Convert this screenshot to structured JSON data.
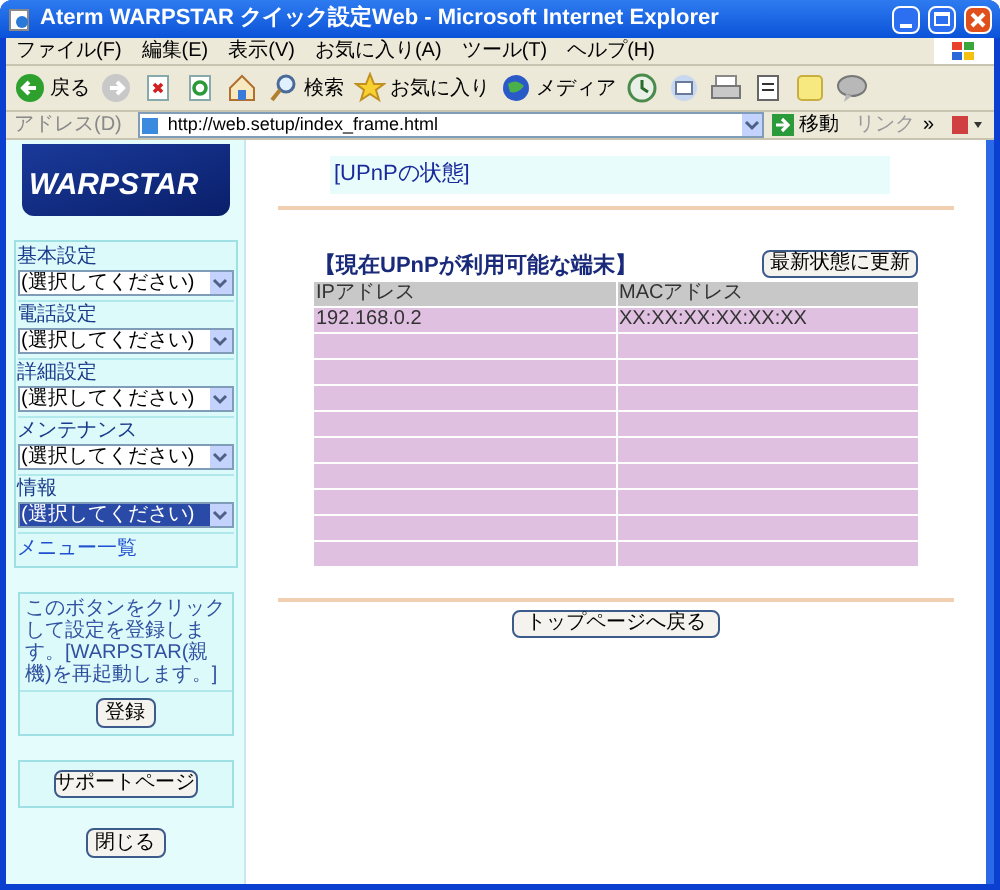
{
  "window": {
    "title": "Aterm WARPSTAR クイック設定Web - Microsoft Internet Explorer"
  },
  "menu": [
    "ファイル(F)",
    "編集(E)",
    "表示(V)",
    "お気に入り(A)",
    "ツール(T)",
    "ヘルプ(H)"
  ],
  "toolbar": [
    {
      "kind": "back",
      "label": "戻る"
    },
    {
      "kind": "forward"
    },
    {
      "kind": "stop"
    },
    {
      "kind": "refresh"
    },
    {
      "kind": "home"
    },
    {
      "kind": "search",
      "label": "検索"
    },
    {
      "kind": "favorites",
      "label": "お気に入り"
    },
    {
      "kind": "media",
      "label": "メディア"
    },
    {
      "kind": "history"
    },
    {
      "kind": "mail"
    },
    {
      "kind": "print"
    },
    {
      "kind": "edit"
    },
    {
      "kind": "note"
    },
    {
      "kind": "chat"
    }
  ],
  "address_bar": {
    "label": "アドレス(D)",
    "url": "http://web.setup/index_frame.html",
    "go": "移動",
    "links": "リンク",
    "more": "»"
  },
  "sidebar": {
    "logo": "WARPSTAR",
    "sections": [
      {
        "label": "基本設定",
        "value": "(選択してください)",
        "focused": false
      },
      {
        "label": "電話設定",
        "value": "(選択してください)",
        "focused": false
      },
      {
        "label": "詳細設定",
        "value": "(選択してください)",
        "focused": false
      },
      {
        "label": "メンテナンス",
        "value": "(選択してください)",
        "focused": false
      },
      {
        "label": "情報",
        "value": "(選択してください)",
        "focused": true
      }
    ],
    "menu_link": "メニュー一覧",
    "save_note": "このボタンをクリックして設定を登録します。[WARPSTAR(親機)を再起動します。]",
    "save_button": "登録",
    "support_button": "サポートページ",
    "close_button": "閉じる"
  },
  "main": {
    "heading": "[UPnPの状態]",
    "subheading": "【現在UPnPが利用可能な端末】",
    "refresh_button": "最新状態に更新",
    "table": {
      "columns": [
        "IPアドレス",
        "MACアドレス"
      ],
      "rows": [
        {
          "ip": "192.168.0.2",
          "mac": "XX:XX:XX:XX:XX:XX"
        },
        {},
        {},
        {},
        {},
        {},
        {},
        {},
        {},
        {}
      ]
    },
    "top_button": "トップページへ戻る"
  }
}
